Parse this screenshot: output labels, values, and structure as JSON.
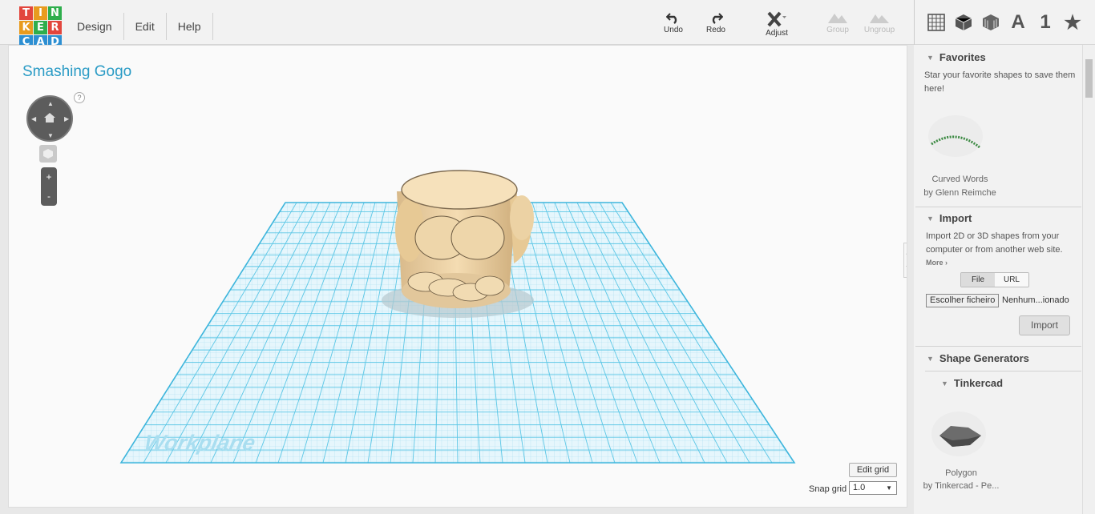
{
  "logo": {
    "letters": [
      "T",
      "I",
      "N",
      "K",
      "E",
      "R",
      "C",
      "A",
      "D"
    ],
    "colors": [
      "#e2463d",
      "#e89b1e",
      "#2eae4c",
      "#e89b1e",
      "#2eae4c",
      "#e2463d",
      "#2d8fd2",
      "#2d8fd2",
      "#2d8fd2"
    ]
  },
  "menu": {
    "items": [
      "Design",
      "Edit",
      "Help"
    ]
  },
  "toolbar": {
    "undo": "Undo",
    "redo": "Redo",
    "adjust": "Adjust",
    "group": "Group",
    "ungroup": "Ungroup"
  },
  "view_icons": [
    {
      "icon": "grid-view-icon"
    },
    {
      "icon": "box-icon"
    },
    {
      "icon": "cage-icon"
    },
    {
      "icon": "letter-icon",
      "text": "A"
    },
    {
      "icon": "number-icon",
      "text": "1"
    },
    {
      "icon": "star-icon",
      "text": "★"
    }
  ],
  "workspace": {
    "title": "Smashing Gogo",
    "workplane_label": "Workplane",
    "help": "?",
    "zoom_in": "+",
    "zoom_out": "-",
    "edit_grid": "Edit grid",
    "snap_grid_label": "Snap grid",
    "snap_grid_value": "1.0",
    "collapse_glyph": "❯"
  },
  "sidebar": {
    "favorites": {
      "title": "Favorites",
      "text": "Star your favorite shapes to save them here!",
      "item_name": "Curved Words",
      "item_author": "by Glenn Reimche"
    },
    "import": {
      "title": "Import",
      "text": "Import 2D or 3D shapes from your computer or from another web site.",
      "more": "More ›",
      "tab_file": "File",
      "tab_url": "URL",
      "choose_file": "Escolher ficheiro",
      "no_file": "Nenhum...ionado",
      "import_button": "Import"
    },
    "shape_generators": {
      "title": "Shape Generators",
      "subtitle": "Tinkercad",
      "item_name": "Polygon",
      "item_author": "by Tinkercad - Pe..."
    }
  },
  "colors": {
    "accent": "#2a9bc5",
    "grid": "#5cc7e6",
    "model": "#f2d9ad"
  }
}
